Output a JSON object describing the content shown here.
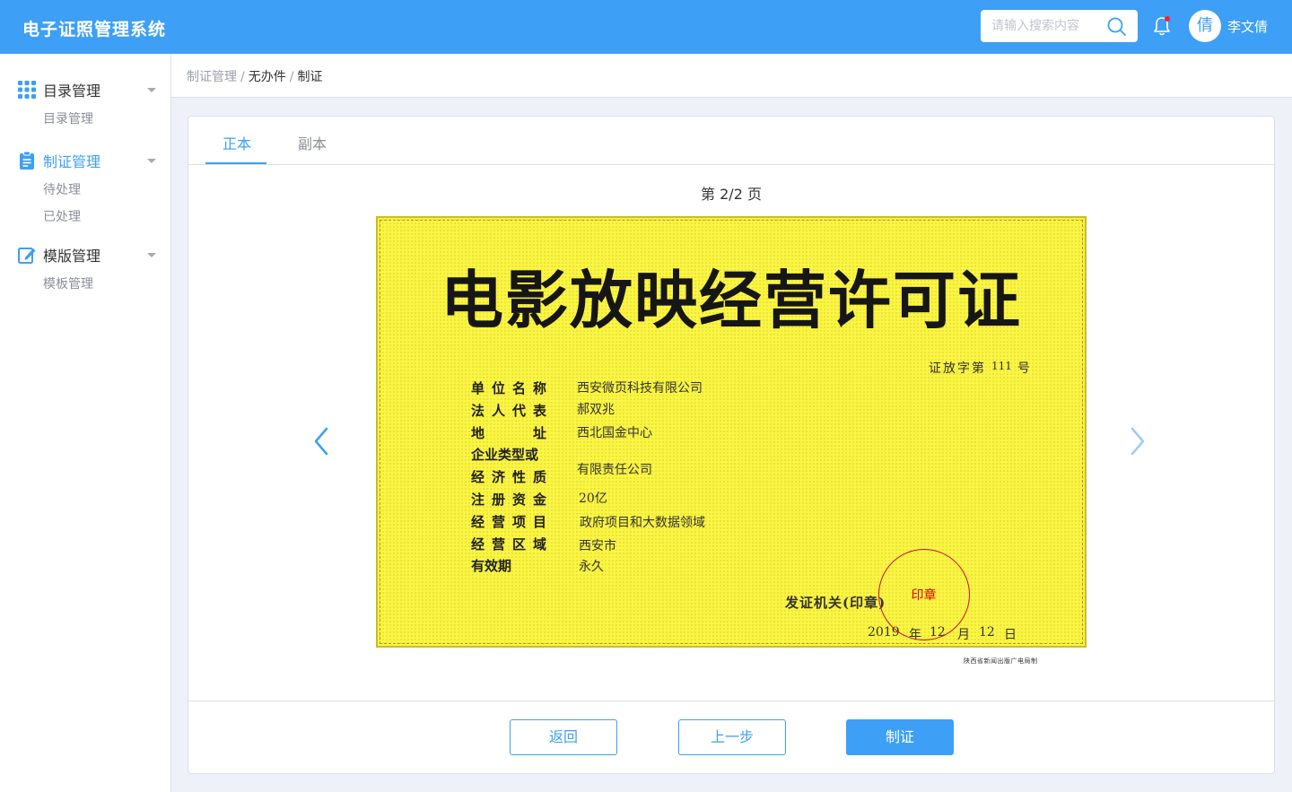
{
  "app": {
    "title": "电子证照管理系统"
  },
  "header": {
    "search_placeholder": "请输入搜索内容",
    "avatar_char": "倩",
    "user_name": "李文倩"
  },
  "sidebar": {
    "groups": [
      {
        "label": "目录管理",
        "icon": "grid-icon",
        "items": [
          "目录管理"
        ]
      },
      {
        "label": "制证管理",
        "icon": "clipboard-icon",
        "items": [
          "待处理",
          "已处理"
        ]
      },
      {
        "label": "模版管理",
        "icon": "edit-icon",
        "items": [
          "模板管理"
        ]
      }
    ]
  },
  "breadcrumb": [
    "制证管理",
    "无办件",
    "制证"
  ],
  "tabs": [
    "正本",
    "副本"
  ],
  "pager": {
    "text": "第 2/2 页"
  },
  "certificate": {
    "title": "电影放映经营许可证",
    "number_prefix": "证放字第",
    "number": "111",
    "number_suffix": "号",
    "fields": [
      {
        "label": "单位名称",
        "value": "西安微页科技有限公司"
      },
      {
        "label": "法人代表",
        "value": "郝双兆"
      },
      {
        "label": "地址",
        "value": "西北国金中心"
      },
      {
        "label": "企业类型或",
        "value": ""
      },
      {
        "label": "经济性质",
        "value": "有限责任公司"
      },
      {
        "label": "注册资金",
        "value": "20亿"
      },
      {
        "label": "经营项目",
        "value": "政府项目和大数据领域"
      },
      {
        "label": "经营区域",
        "value": "西安市"
      },
      {
        "label": "有效期",
        "value": "永久"
      }
    ],
    "issuer": "发证机关(印章)",
    "stamp_text": "印章",
    "date": {
      "year": "2019",
      "year_unit": "年",
      "month": "12",
      "month_unit": "月",
      "day": "12",
      "day_unit": "日"
    },
    "footer": "陕西省新闻出版广电局制"
  },
  "buttons": {
    "back": "返回",
    "prev": "上一步",
    "issue": "制证"
  },
  "colors": {
    "primary": "#3d9ff5",
    "certificate": "#fbf543",
    "stamp": "#c8102e"
  }
}
